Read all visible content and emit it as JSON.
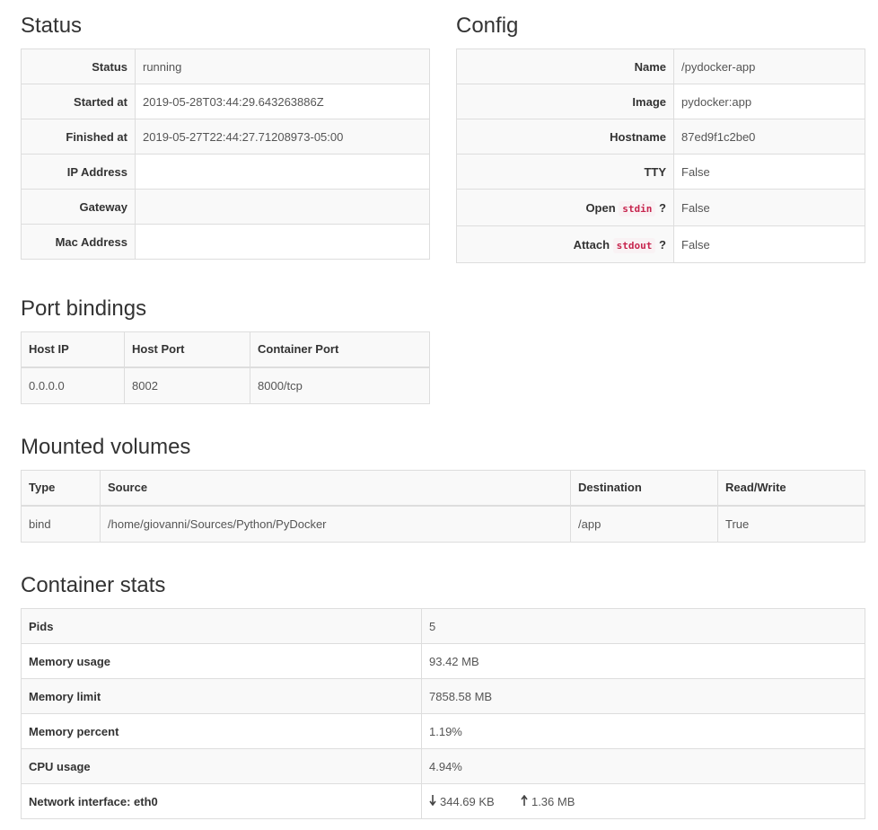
{
  "status": {
    "title": "Status",
    "rows": [
      {
        "label": "Status",
        "value": "running"
      },
      {
        "label": "Started at",
        "value": "2019-05-28T03:44:29.643263886Z"
      },
      {
        "label": "Finished at",
        "value": "2019-05-27T22:44:27.71208973-05:00"
      },
      {
        "label": "IP Address",
        "value": ""
      },
      {
        "label": "Gateway",
        "value": ""
      },
      {
        "label": "Mac Address",
        "value": ""
      }
    ]
  },
  "config": {
    "title": "Config",
    "rows": [
      {
        "label": "Name",
        "value": "/pydocker-app"
      },
      {
        "label": "Image",
        "value": "pydocker:app"
      },
      {
        "label": "Hostname",
        "value": "87ed9f1c2be0"
      },
      {
        "label": "TTY",
        "value": "False"
      },
      {
        "label_prefix": "Open",
        "label_code": "stdin",
        "label_suffix": "?",
        "value": "False"
      },
      {
        "label_prefix": "Attach",
        "label_code": "stdout",
        "label_suffix": "?",
        "value": "False"
      }
    ]
  },
  "ports": {
    "title": "Port bindings",
    "headers": [
      "Host IP",
      "Host Port",
      "Container Port"
    ],
    "rows": [
      [
        "0.0.0.0",
        "8002",
        "8000/tcp"
      ]
    ]
  },
  "volumes": {
    "title": "Mounted volumes",
    "headers": [
      "Type",
      "Source",
      "Destination",
      "Read/Write"
    ],
    "rows": [
      [
        "bind",
        "/home/giovanni/Sources/Python/PyDocker",
        "/app",
        "True"
      ]
    ]
  },
  "stats": {
    "title": "Container stats",
    "rows": [
      {
        "label": "Pids",
        "value": "5"
      },
      {
        "label": "Memory usage",
        "value": "93.42 MB"
      },
      {
        "label": "Memory limit",
        "value": "7858.58 MB"
      },
      {
        "label": "Memory percent",
        "value": "1.19%"
      },
      {
        "label": "CPU usage",
        "value": "4.94%"
      }
    ],
    "network": {
      "label": "Network interface: eth0",
      "rx": "344.69 KB",
      "tx": "1.36 MB",
      "rx_icon": "arrow-down-icon",
      "tx_icon": "arrow-up-icon"
    }
  }
}
